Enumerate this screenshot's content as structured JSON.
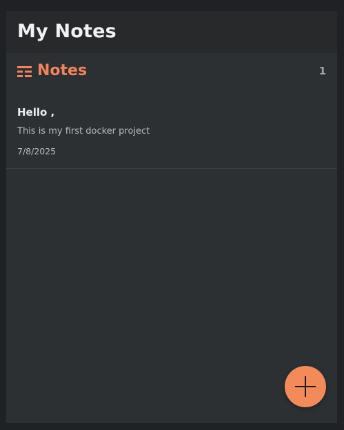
{
  "header": {
    "title": "My Notes"
  },
  "section": {
    "title": "Notes",
    "count": "1",
    "icon": "list-icon"
  },
  "notes": [
    {
      "title": "Hello ,",
      "body": "This is my first docker project",
      "date": "7/8/2025"
    }
  ],
  "fab": {
    "icon": "plus-icon"
  },
  "colors": {
    "accent": "#f0845c",
    "fab": "#f28a5a",
    "background": "#2d3033",
    "header_bg": "#28292b"
  }
}
